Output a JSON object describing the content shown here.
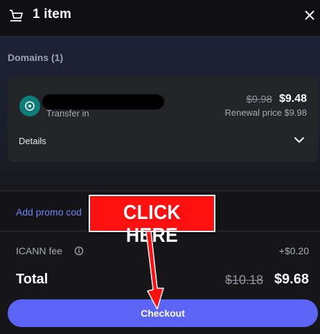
{
  "header": {
    "title": "1 item",
    "cart_icon": "cart-icon",
    "close_icon": "close-icon"
  },
  "domains": {
    "section_title": "Domains (1)",
    "item": {
      "icon": "domain-transfer-icon",
      "icon_color": "#0c7d78",
      "subtitle": "Transfer in",
      "old_price": "$9.98",
      "new_price": "$9.48",
      "renewal": "Renewal price $9.98",
      "details_label": "Details"
    }
  },
  "promo": {
    "link_label": "Add promo cod"
  },
  "fees": {
    "icann_label": "ICANN fee",
    "icann_value": "+$0.20"
  },
  "total": {
    "label": "Total",
    "old_value": "$10.18",
    "new_value": "$9.68"
  },
  "checkout": {
    "label": "Checkout",
    "color": "#5b64f5"
  },
  "annotation": {
    "text": "CLICK HERE",
    "color": "#ff1010"
  }
}
